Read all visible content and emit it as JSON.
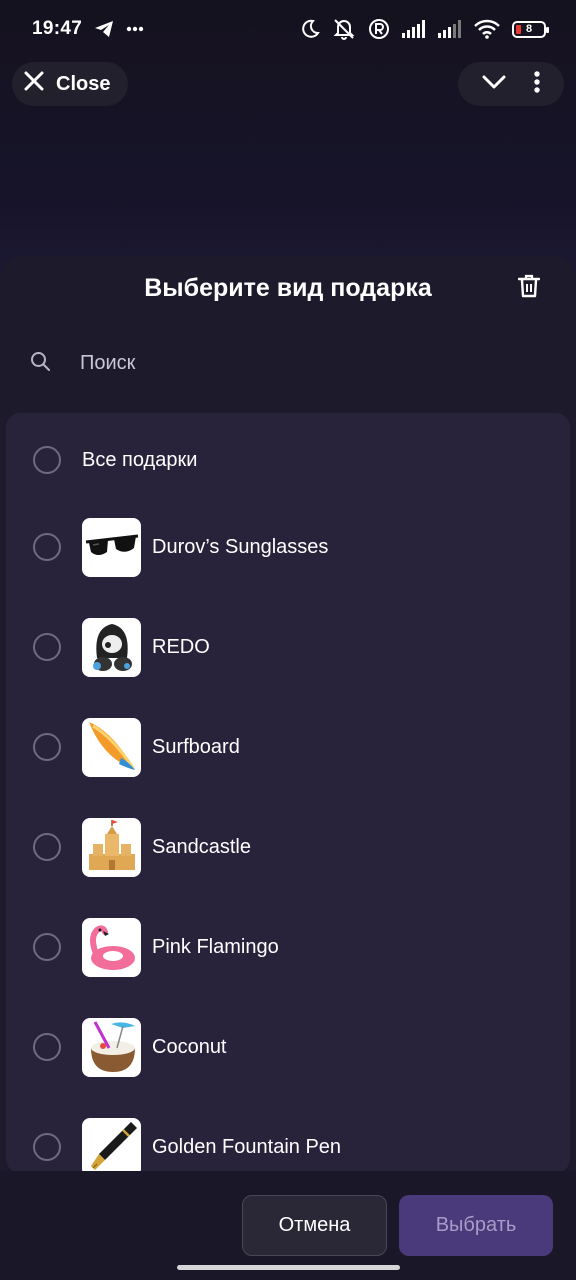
{
  "status_bar": {
    "time": "19:47",
    "battery_level": "8",
    "icons": [
      "telegram-icon",
      "more-dots-icon",
      "moon-icon",
      "muted-icon",
      "registered-icon",
      "signal-icon",
      "signal-icon",
      "wifi-icon",
      "battery-icon"
    ]
  },
  "top_bar": {
    "close_label": "Close"
  },
  "sheet": {
    "title": "Выберите вид подарка",
    "search_placeholder": "Поиск"
  },
  "items": [
    {
      "label": "Все подарки",
      "thumb": null
    },
    {
      "label": "Durov’s Sunglasses",
      "thumb": "sunglasses"
    },
    {
      "label": "REDO",
      "thumb": "redo-creature"
    },
    {
      "label": "Surfboard",
      "thumb": "surfboard"
    },
    {
      "label": "Sandcastle",
      "thumb": "sandcastle"
    },
    {
      "label": "Pink Flamingo",
      "thumb": "flamingo-float"
    },
    {
      "label": "Coconut",
      "thumb": "coconut-drink"
    },
    {
      "label": "Golden Fountain Pen",
      "thumb": "fountain-pen"
    }
  ],
  "buttons": {
    "cancel": "Отмена",
    "select": "Выбрать"
  },
  "colors": {
    "background": "#15121f",
    "sheet": "#1d1a2c",
    "list_card": "#28223b",
    "select_button": "#4a3a7c",
    "battery_low": "#e53935"
  }
}
